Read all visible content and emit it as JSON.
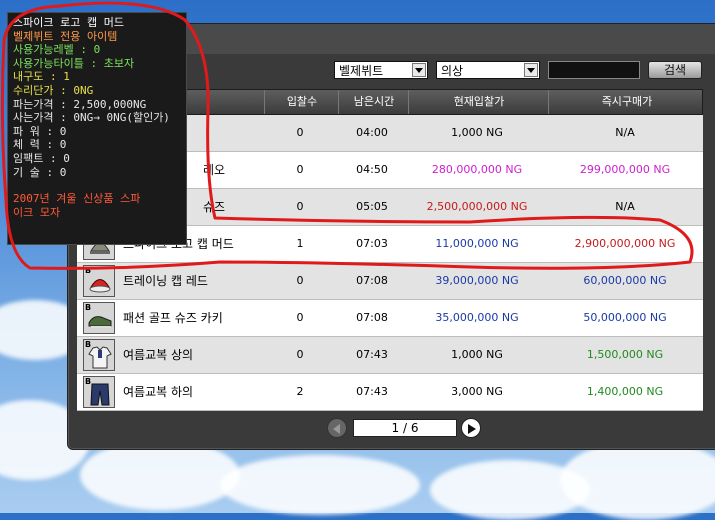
{
  "colors": {
    "tooltip_title": "#ffffff",
    "tooltip_orange": "#ff9a4a",
    "tooltip_green": "#7ee25e",
    "tooltip_yellow": "#e7e04a",
    "tooltip_white": "#e8e8e8",
    "tooltip_red": "#ff5a3a",
    "price_blue": "#1a3aa8",
    "price_magenta": "#d01ed0",
    "price_red": "#c81a1a",
    "price_green": "#1f8a1f",
    "annotation_red": "#e01a1a"
  },
  "filters": {
    "category_value": "벨제뷔트",
    "type_value": "의상",
    "search_value": "",
    "search_label": "검색"
  },
  "table": {
    "headers": {
      "name": "",
      "bids": "입찰수",
      "time_left": "남은시간",
      "current_bid": "현재입찰가",
      "buyout": "즉시구매가"
    },
    "rows": [
      {
        "name": "",
        "bids": "0",
        "time": "04:00",
        "current": "1,000 NG",
        "current_color": "#000000",
        "buyout": "N/A",
        "buyout_color": "#000000",
        "icon": "none"
      },
      {
        "name": "레오",
        "bids": "0",
        "time": "04:50",
        "current": "280,000,000 NG",
        "current_color": "#d01ed0",
        "buyout": "299,000,000 NG",
        "buyout_color": "#d01ed0",
        "icon": "none"
      },
      {
        "name": "슈즈",
        "bids": "0",
        "time": "05:05",
        "current": "2,500,000,000 NG",
        "current_color": "#c81a1a",
        "buyout": "N/A",
        "buyout_color": "#000000",
        "icon": "none"
      },
      {
        "name": "스파이크 로고 캡 머드",
        "bids": "1",
        "time": "07:03",
        "current": "11,000,000 NG",
        "current_color": "#1a3aa8",
        "buyout": "2,900,000,000 NG",
        "buyout_color": "#c81a1a",
        "icon": "cap-icon"
      },
      {
        "name": "트레이닝 캡 레드",
        "bids": "0",
        "time": "07:08",
        "current": "39,000,000 NG",
        "current_color": "#1a3aa8",
        "buyout": "60,000,000 NG",
        "buyout_color": "#1a3aa8",
        "icon": "red-cap-icon"
      },
      {
        "name": "패션 골프 슈즈 카키",
        "bids": "0",
        "time": "07:08",
        "current": "35,000,000 NG",
        "current_color": "#1a3aa8",
        "buyout": "50,000,000 NG",
        "buyout_color": "#1a3aa8",
        "icon": "golf-shoes-icon"
      },
      {
        "name": "여름교복 상의",
        "bids": "0",
        "time": "07:43",
        "current": "1,000 NG",
        "current_color": "#000000",
        "buyout": "1,500,000 NG",
        "buyout_color": "#1f8a1f",
        "icon": "uniform-top-icon"
      },
      {
        "name": "여름교복 하의",
        "bids": "2",
        "time": "07:43",
        "current": "3,000 NG",
        "current_color": "#000000",
        "buyout": "1,400,000 NG",
        "buyout_color": "#1f8a1f",
        "icon": "uniform-pants-icon"
      }
    ]
  },
  "pager": {
    "label": "1 / 6"
  },
  "tooltip": {
    "title": "스파이크 로고 캡 머드",
    "exclusive": "벨제뷔트 전용 아이템",
    "req_level": "사용가능레벨 : 0",
    "req_title": "사용가능타이틀 : 초보자",
    "durability": "내구도 : 1",
    "repair_cost": "수리단가 : 0NG",
    "sell_price": "파는가격 : 2,500,000NG",
    "buy_price": "사는가격 : 0NG→ 0NG(할인가)",
    "power": "파 워 : 0",
    "stamina": "체 력 : 0",
    "impact": "임팩트 : 0",
    "technique": "기 술 : 0",
    "desc_line1": "2007년 겨울 신상품 스파",
    "desc_line2": "이크 모자"
  }
}
